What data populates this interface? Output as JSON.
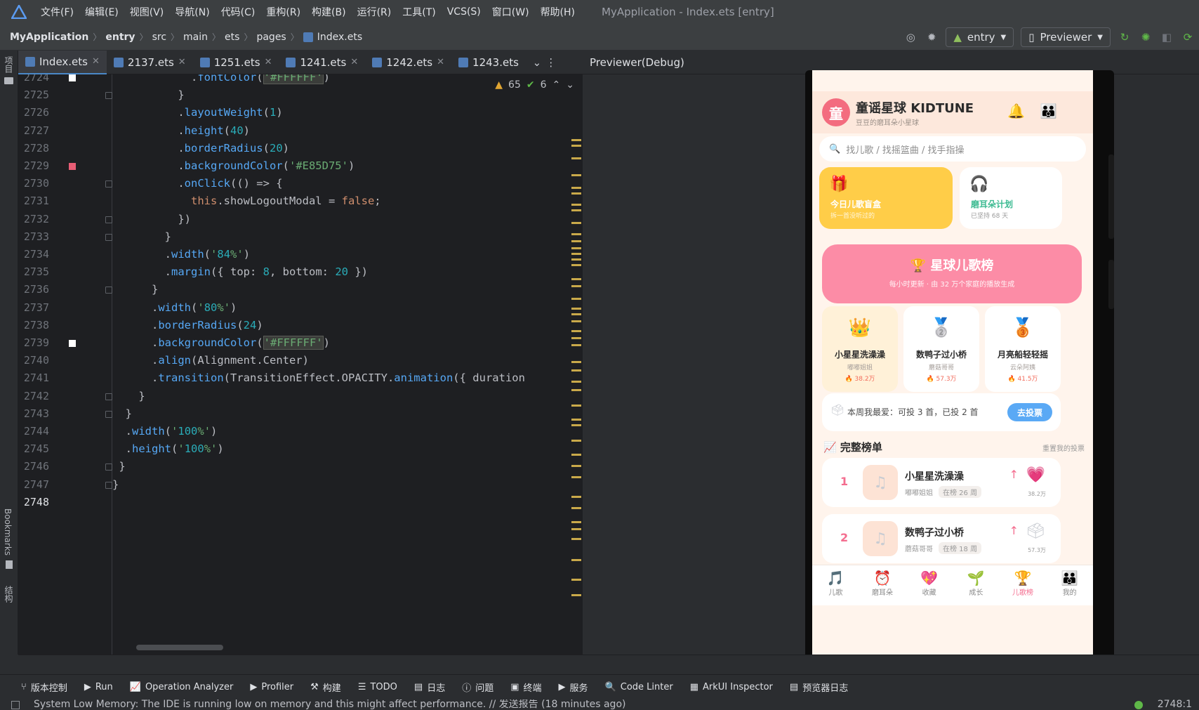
{
  "menu": [
    "文件(F)",
    "编辑(E)",
    "视图(V)",
    "导航(N)",
    "代码(C)",
    "重构(R)",
    "构建(B)",
    "运行(R)",
    "工具(T)",
    "VCS(S)",
    "窗口(W)",
    "帮助(H)"
  ],
  "window_title": "MyApplication - Index.ets [entry]",
  "breadcrumb": [
    "MyApplication",
    "entry",
    "src",
    "main",
    "ets",
    "pages",
    "Index.ets"
  ],
  "run_config": {
    "module": "entry",
    "device": "Previewer"
  },
  "left_strip": {
    "project": "项目",
    "bookmarks": "Bookmarks",
    "structure": "结构"
  },
  "tabs": [
    "Index.ets",
    "2137.ets",
    "1251.ets",
    "1241.ets",
    "1242.ets",
    "1243.ets"
  ],
  "inspections": {
    "warnings": "65",
    "ok": "6"
  },
  "code_lines": [
    {
      "n": "2724",
      "code": "            .fontColor('#FFFFFF')"
    },
    {
      "n": "2725",
      "code": "          }"
    },
    {
      "n": "2726",
      "code": "          .layoutWeight(1)"
    },
    {
      "n": "2727",
      "code": "          .height(40)"
    },
    {
      "n": "2728",
      "code": "          .borderRadius(20)"
    },
    {
      "n": "2729",
      "code": "          .backgroundColor('#E85D75')"
    },
    {
      "n": "2730",
      "code": "          .onClick(() => {"
    },
    {
      "n": "2731",
      "code": "            this.showLogoutModal = false;"
    },
    {
      "n": "2732",
      "code": "          })"
    },
    {
      "n": "2733",
      "code": "        }"
    },
    {
      "n": "2734",
      "code": "        .width('84%')"
    },
    {
      "n": "2735",
      "code": "        .margin({ top: 8, bottom: 20 })"
    },
    {
      "n": "2736",
      "code": "      }"
    },
    {
      "n": "2737",
      "code": "      .width('80%')"
    },
    {
      "n": "2738",
      "code": "      .borderRadius(24)"
    },
    {
      "n": "2739",
      "code": "      .backgroundColor('#FFFFFF')"
    },
    {
      "n": "2740",
      "code": "      .align(Alignment.Center)"
    },
    {
      "n": "2741",
      "code": "      .transition(TransitionEffect.OPACITY.animation({ duration"
    },
    {
      "n": "2742",
      "code": "    }"
    },
    {
      "n": "2743",
      "code": "  }"
    },
    {
      "n": "2744",
      "code": "  .width('100%')"
    },
    {
      "n": "2745",
      "code": "  .height('100%')"
    },
    {
      "n": "2746",
      "code": " }"
    },
    {
      "n": "2747",
      "code": "}"
    },
    {
      "n": "2748",
      "code": ""
    }
  ],
  "previewer": {
    "title": "Previewer(Debug)"
  },
  "app": {
    "avatar": "童",
    "title": "童谣星球 KIDTUNE",
    "subtitle": "豆豆的磨耳朵小星球",
    "search_placeholder": "找儿歌 / 找摇篮曲 / 找手指操",
    "card1": {
      "title": "今日儿歌盲盒",
      "sub": "拆一首没听过的"
    },
    "card2": {
      "title": "磨耳朵计划",
      "sub": "已坚持 68 天"
    },
    "rank_banner": {
      "title": "星球儿歌榜",
      "sub": "每小时更新 · 由 32 万个家庭的播放生成"
    },
    "podium": [
      {
        "title": "小星星洗澡澡",
        "artist": "嘟嘟姐姐",
        "plays": "38.2万"
      },
      {
        "title": "数鸭子过小桥",
        "artist": "蘑菇哥哥",
        "plays": "57.3万"
      },
      {
        "title": "月亮船轻轻摇",
        "artist": "云朵阿姨",
        "plays": "41.5万"
      }
    ],
    "vote": {
      "text": "本周我最爱：可投 3 首，已投 2 首",
      "button": "去投票"
    },
    "list": {
      "title": "完整榜单",
      "more": "重置我的投票"
    },
    "rows": [
      {
        "rank": "1",
        "title": "小星星洗澡澡",
        "artist": "嘟嘟姐姐",
        "weeks": "在榜 26 周",
        "count": "38.2万"
      },
      {
        "rank": "2",
        "title": "数鸭子过小桥",
        "artist": "蘑菇哥哥",
        "weeks": "在榜 18 周",
        "count": "57.3万"
      }
    ],
    "tabbar": [
      "儿歌",
      "磨耳朵",
      "收藏",
      "成长",
      "儿歌榜",
      "我的"
    ]
  },
  "bottom_tools": [
    "版本控制",
    "Run",
    "Operation Analyzer",
    "Profiler",
    "构建",
    "TODO",
    "日志",
    "问题",
    "终端",
    "服务",
    "Code Linter",
    "ArkUI Inspector",
    "预览器日志"
  ],
  "status": {
    "message": "System Low Memory: The IDE is running low on memory and this might affect performance. // 发送报告 (18 minutes ago)",
    "position": "2748:1"
  },
  "colors": {
    "accent": "#4a88c7",
    "pink": "#f46d8f",
    "yellow": "#ffcd48",
    "blue": "#5aa9f5"
  }
}
